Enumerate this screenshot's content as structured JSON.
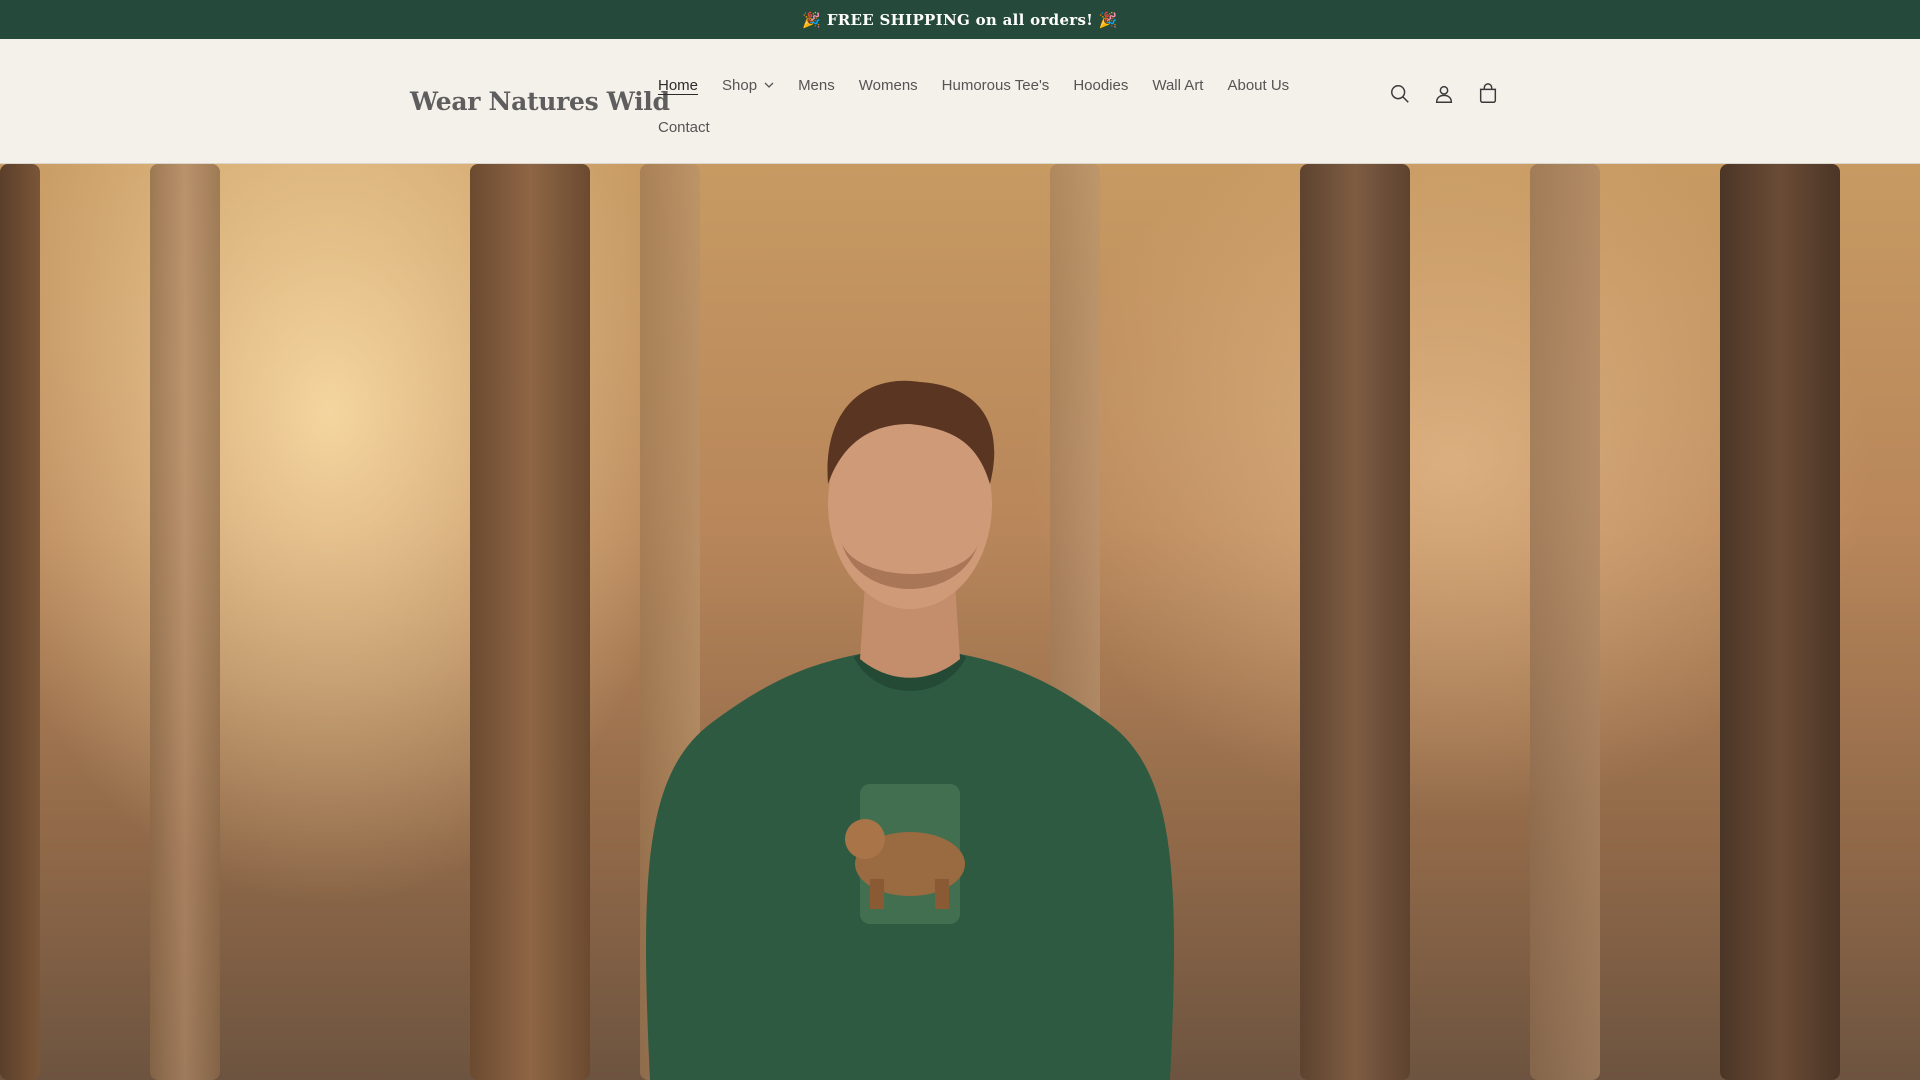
{
  "announcement": {
    "text": "🎉 FREE SHIPPING on all orders! 🎉"
  },
  "header": {
    "logo": "Wear Natures Wild",
    "nav": [
      {
        "label": "Home",
        "active": true
      },
      {
        "label": "Shop",
        "has_dropdown": true
      },
      {
        "label": "Mens"
      },
      {
        "label": "Womens"
      },
      {
        "label": "Humorous Tee's"
      },
      {
        "label": "Hoodies"
      },
      {
        "label": "Wall Art"
      },
      {
        "label": "About Us"
      },
      {
        "label": "Contact"
      }
    ],
    "icons": [
      "search-icon",
      "account-icon",
      "cart-icon"
    ]
  },
  "hero": {
    "image": "man-wearing-green-bear-sweatshirt-in-foggy-forest"
  },
  "colors": {
    "announcement_bg": "#254a3c",
    "header_bg": "#f4f0ea",
    "sweatshirt": "#2e5a41"
  }
}
